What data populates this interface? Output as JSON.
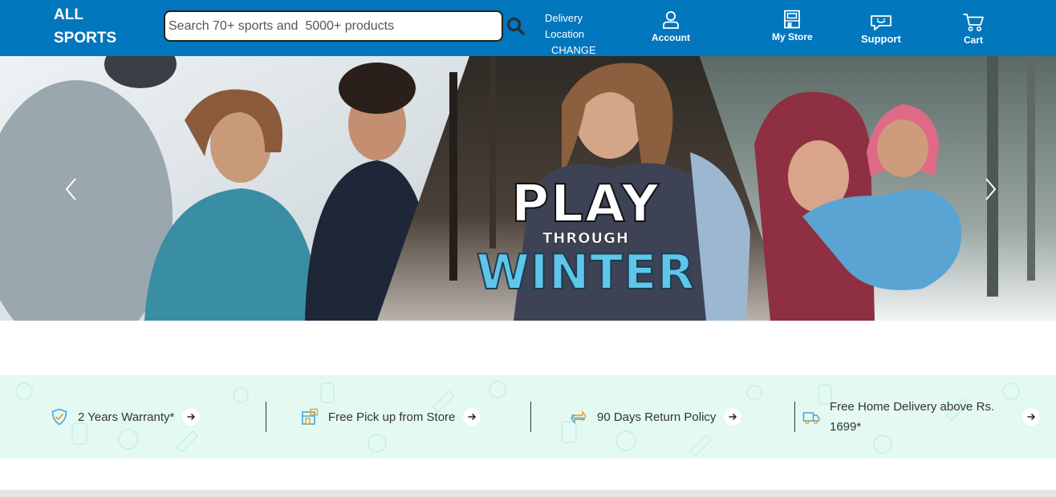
{
  "brand": {
    "line1": "ALL",
    "line2": "SPORTS"
  },
  "search": {
    "placeholder": "Search 70+ sports and  5000+ products",
    "button_icon": "search-icon"
  },
  "delivery": {
    "line1": "Delivery",
    "line2": "Location",
    "action": "CHANGE"
  },
  "nav": [
    {
      "label": "Account",
      "icon": "user-icon"
    },
    {
      "label": "My Store",
      "icon": "store-icon"
    },
    {
      "label": "Support",
      "icon": "chat-icon"
    },
    {
      "label": "Cart",
      "icon": "cart-icon"
    }
  ],
  "hero": {
    "title_line1": "PLAY",
    "title_line2": "THROUGH",
    "title_line3": "WINTER",
    "prev_icon": "chevron-left-icon",
    "next_icon": "chevron-right-icon"
  },
  "features": [
    {
      "text": "2 Years Warranty*",
      "icon": "shield-check-icon"
    },
    {
      "text": "Free Pick up from Store",
      "icon": "store-pickup-icon"
    },
    {
      "text": "90 Days Return Policy",
      "icon": "return-icon"
    },
    {
      "text": "Free Home Delivery above Rs. 1699*",
      "icon": "delivery-truck-icon"
    }
  ],
  "colors": {
    "header": "#0277bd",
    "features_bg": "#e3f9f2",
    "winter_text": "#5fc6ea"
  }
}
